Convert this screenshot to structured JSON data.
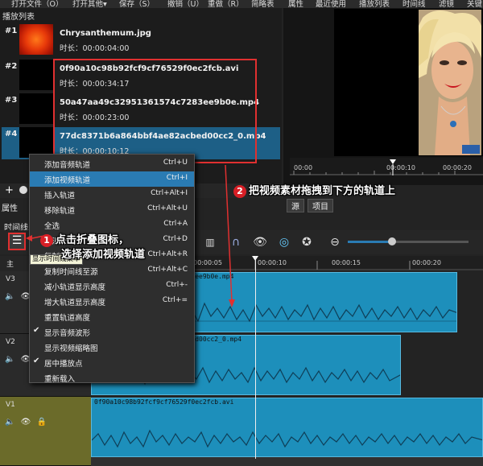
{
  "menubar": [
    "打开文件（O）",
    "打开其他▾",
    "保存（S）",
    "撤销（U）",
    "重做（R）",
    "简略表",
    "属性",
    "最近使用",
    "播放列表",
    "时间线",
    "滤镜",
    "关键"
  ],
  "playlist": {
    "title": "播放列表",
    "items": [
      {
        "num": "#1",
        "name": "Chrysanthemum.jpg",
        "duration": "时长：00:00:04:00"
      },
      {
        "num": "#2",
        "name": "0f90a10c98b92fcf9cf76529f0ec2fcb.avi",
        "duration": "时长：00:00:34:17"
      },
      {
        "num": "#3",
        "name": "50a47aa49c32951361574c7283ee9b0e.mp4",
        "duration": "时长：00:00:23:00"
      },
      {
        "num": "#4",
        "name": "77dc8371b6a864bbf4ae82acbed00cc2_0.mp4",
        "duration": "时长：00:00:10:12"
      }
    ]
  },
  "preview": {
    "ruler": [
      "00:00",
      "00:00:10",
      "00:00:20"
    ],
    "tabs": [
      "源",
      "项目"
    ]
  },
  "props_tab": "属性",
  "timeline": {
    "label": "时间线",
    "ruler": [
      "00:00:05",
      "00:00:10",
      "00:00:15",
      "00:00:20"
    ],
    "tooltip": "显示时间线菜单",
    "tracks": [
      {
        "name": "主"
      },
      {
        "name": "V3",
        "clip": "50a47aa49c32951361574c7283ee9b0e.mp4"
      },
      {
        "name": "V2",
        "clip": "77dc8371b6a864bbf4ae82acbed00cc2_0.mp4"
      },
      {
        "name": "V1",
        "clip": "0f90a10c98b92fcf9cf76529f0ec2fcb.avi"
      }
    ]
  },
  "menu": [
    {
      "label": "添加音频轨道",
      "shortcut": "Ctrl+U",
      "check": ""
    },
    {
      "label": "添加视频轨道",
      "shortcut": "Ctrl+I",
      "check": ""
    },
    {
      "label": "插入轨道",
      "shortcut": "Ctrl+Alt+I",
      "check": ""
    },
    {
      "label": "移除轨道",
      "shortcut": "Ctrl+Alt+U",
      "check": ""
    },
    {
      "label": "全选",
      "shortcut": "Ctrl+A",
      "check": ""
    },
    {
      "label": "取消全选",
      "shortcut": "Ctrl+D",
      "check": ""
    },
    {
      "label": "复制时间线",
      "shortcut": "Ctrl+Alt+R",
      "check": ""
    },
    {
      "label": "复制时间线至源",
      "shortcut": "Ctrl+Alt+C",
      "check": ""
    },
    {
      "label": "减小轨道显示高度",
      "shortcut": "Ctrl+-",
      "check": ""
    },
    {
      "label": "增大轨道显示高度",
      "shortcut": "Ctrl+=",
      "check": ""
    },
    {
      "label": "重置轨道高度",
      "shortcut": "",
      "check": ""
    },
    {
      "label": "显示音频波形",
      "shortcut": "",
      "check": "✔"
    },
    {
      "label": "显示视频缩略图",
      "shortcut": "",
      "check": ""
    },
    {
      "label": "居中播放点",
      "shortcut": "",
      "check": "✔"
    },
    {
      "label": "重新载入",
      "shortcut": "",
      "check": ""
    }
  ],
  "annotations": {
    "step1_num": "1",
    "step1_line1": "点击折叠图标，",
    "step1_line2": "选择添加视频轨道",
    "step2_num": "2",
    "step2_text": "把视频素材拖拽到下方的轨道上"
  },
  "colors": {
    "accent": "#2a7bb3",
    "clip": "#1d8fbb",
    "annotation": "#e03030"
  }
}
